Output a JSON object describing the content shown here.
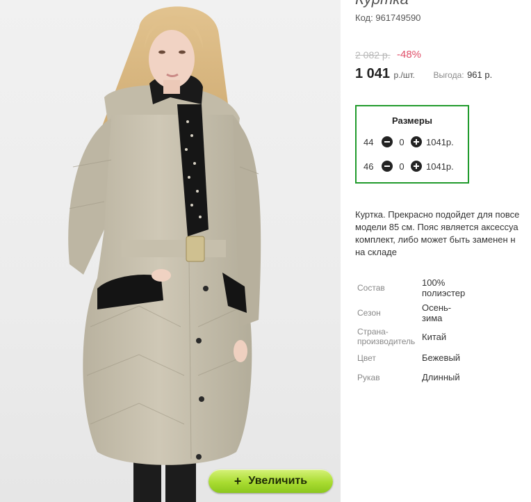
{
  "product": {
    "title": "Куртка",
    "code_label": "Код:",
    "code_value": "961749590"
  },
  "pricing": {
    "old_price": "2 082 р.",
    "discount": "-48%",
    "price": "1 041",
    "unit": "р./шт.",
    "saving_label": "Выгода:",
    "saving_value": "961 р."
  },
  "sizes": {
    "title": "Размеры",
    "rows": [
      {
        "size": "44",
        "qty": "0",
        "price": "1041р."
      },
      {
        "size": "46",
        "qty": "0",
        "price": "1041р."
      }
    ],
    "border_color": "#1f9a2b"
  },
  "description": [
    "Куртка. Прекрасно подойдет для повсе",
    "модели 85 см. Пояс является аксессуа",
    "комплект, либо может быть заменен н",
    "на складе"
  ],
  "specs": [
    {
      "label": "Состав",
      "value": "100%\nполиэстер"
    },
    {
      "label": "Сезон",
      "value": "Осень-\nзима"
    },
    {
      "label": "Страна-\nпроизводитель",
      "value": "Китай"
    },
    {
      "label": "Цвет",
      "value": "Бежевый"
    },
    {
      "label": "Рукав",
      "value": "Длинный"
    }
  ],
  "zoom_button": {
    "icon": "plus-icon",
    "label": "Увеличить"
  },
  "colors": {
    "discount": "#e04e68",
    "button": "#a9dc31"
  }
}
